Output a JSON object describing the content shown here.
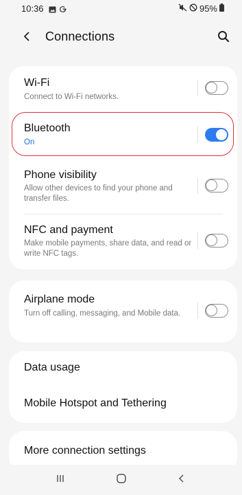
{
  "status_bar": {
    "time": "10:36",
    "left_icons": [
      "gallery-icon",
      "google-icon"
    ],
    "right_icons": [
      "mute-icon",
      "do-not-disturb-icon"
    ],
    "battery_text": "95%"
  },
  "header": {
    "title": "Connections"
  },
  "card1": {
    "items": [
      {
        "title": "Wi-Fi",
        "subtitle": "Connect to Wi-Fi networks.",
        "toggle": "off"
      },
      {
        "title": "Bluetooth",
        "subtitle": "On",
        "toggle": "on"
      },
      {
        "title": "Phone visibility",
        "subtitle": "Allow other devices to find your phone and transfer files.",
        "toggle": "off"
      },
      {
        "title": "NFC and payment",
        "subtitle": "Make mobile payments, share data, and read or write NFC tags.",
        "toggle": "off"
      }
    ]
  },
  "card2": {
    "items": [
      {
        "title": "Airplane mode",
        "subtitle": "Turn off calling, messaging, and Mobile data.",
        "toggle": "off"
      }
    ]
  },
  "card3": {
    "items": [
      {
        "title": "Data usage"
      },
      {
        "title": "Mobile Hotspot and Tethering"
      }
    ]
  },
  "card4": {
    "items": [
      {
        "title": "More connection settings"
      }
    ]
  },
  "nav_bar": {
    "buttons": [
      "recent-apps-icon",
      "home-icon",
      "back-icon"
    ]
  },
  "colors": {
    "accent": "#2d7df0",
    "highlight": "#e0303a",
    "background": "#f5f5f5"
  }
}
